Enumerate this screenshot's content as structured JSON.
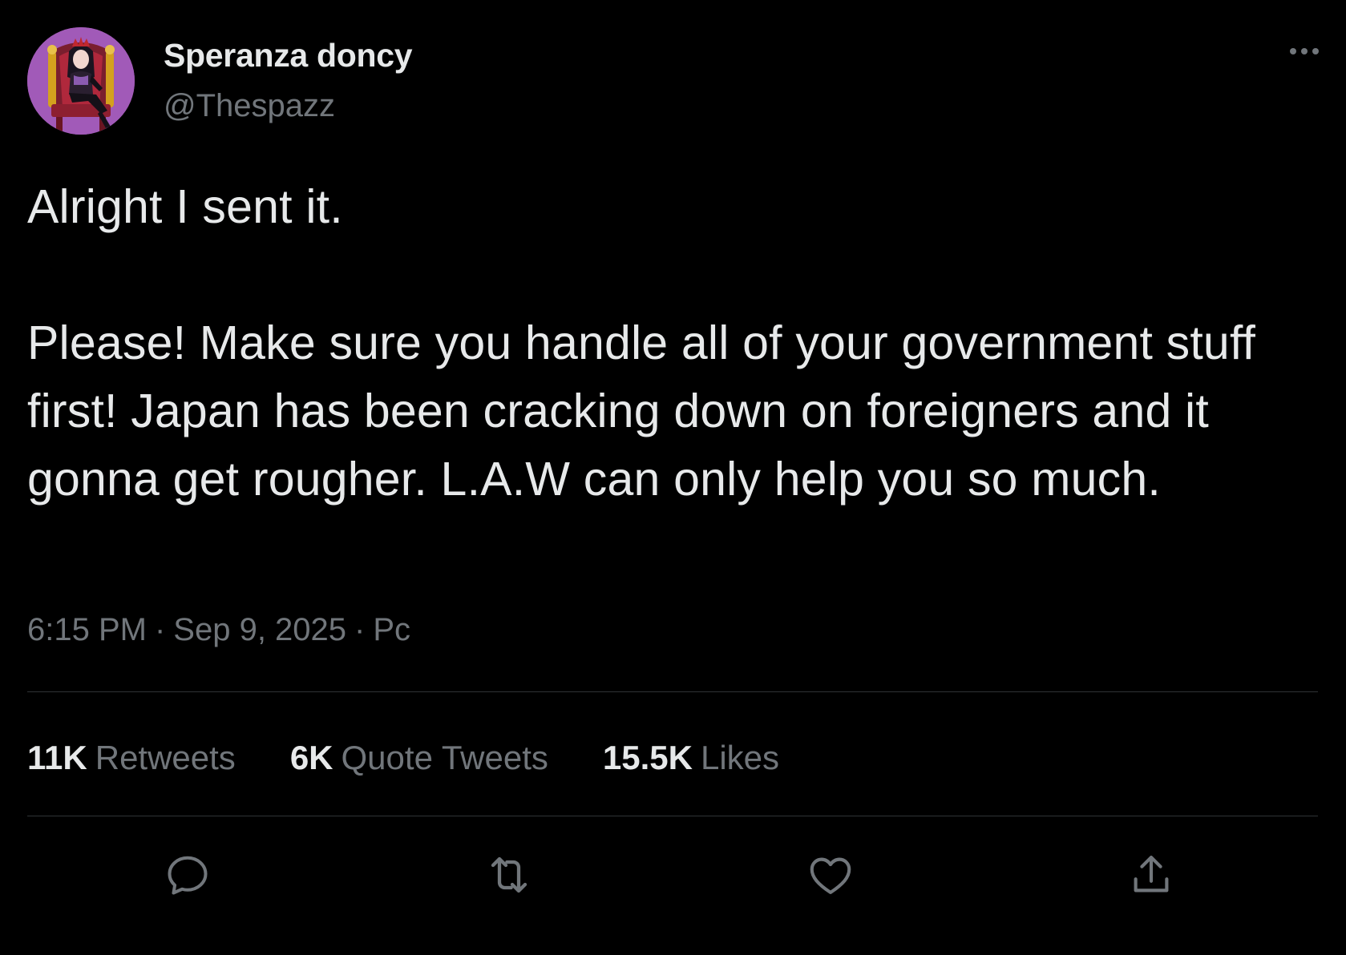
{
  "author": {
    "display_name": "Speranza doncy",
    "handle": "@Thespazz"
  },
  "tweet": {
    "paragraph_1": "Alright I sent it.",
    "paragraph_2": "Please! Make sure you handle all of your government stuff first! Japan has been cracking down on foreigners and it gonna get rougher. L.A.W can only help you so much.",
    "time": "6:15 PM",
    "separator": "·",
    "date": "Sep 9, 2025",
    "source": "Pc"
  },
  "stats": {
    "retweets_count": "11K",
    "retweets_label": "Retweets",
    "quotes_count": "6K",
    "quotes_label": "Quote Tweets",
    "likes_count": "15.5K",
    "likes_label": "Likes"
  },
  "icons": {
    "more": "more-horizontal-icon",
    "reply": "reply-icon",
    "retweet": "retweet-icon",
    "like": "heart-icon",
    "share": "share-icon"
  },
  "colors": {
    "background": "#000000",
    "primary_text": "#e7e9ea",
    "secondary_text": "#71767b",
    "divider": "#2f3336",
    "avatar_bg": "#a15ab8"
  }
}
